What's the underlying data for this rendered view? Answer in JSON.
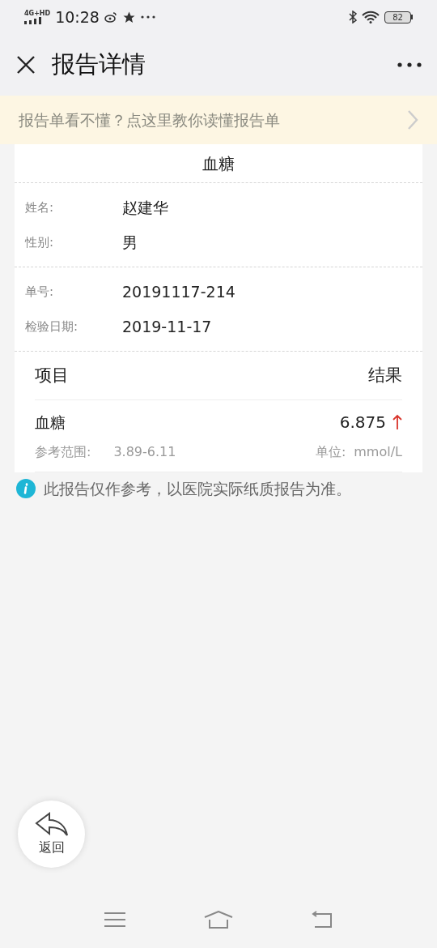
{
  "status_bar": {
    "network": "4G+HD",
    "time": "10:28",
    "battery": "82"
  },
  "header": {
    "title": "报告详情"
  },
  "banner": {
    "text": "报告单看不懂？点这里教你读懂报告单"
  },
  "report": {
    "title": "血糖",
    "patient": [
      {
        "label": "姓名:",
        "value": "赵建华"
      },
      {
        "label": "性别:",
        "value": "男"
      }
    ],
    "order": [
      {
        "label": "单号:",
        "value": "20191117-214"
      },
      {
        "label": "检验日期:",
        "value": "2019-11-17"
      }
    ],
    "columns": [
      "项目",
      "结果"
    ],
    "results": [
      {
        "name": "血糖",
        "value": "6.875",
        "high": true,
        "range_label": "参考范围:",
        "range": "3.89-6.11",
        "unit_label": "单位:",
        "unit": "mmol/L"
      }
    ]
  },
  "note": "此报告仅作参考，以医院实际纸质报告为准。",
  "float_button": {
    "label": "返回"
  }
}
